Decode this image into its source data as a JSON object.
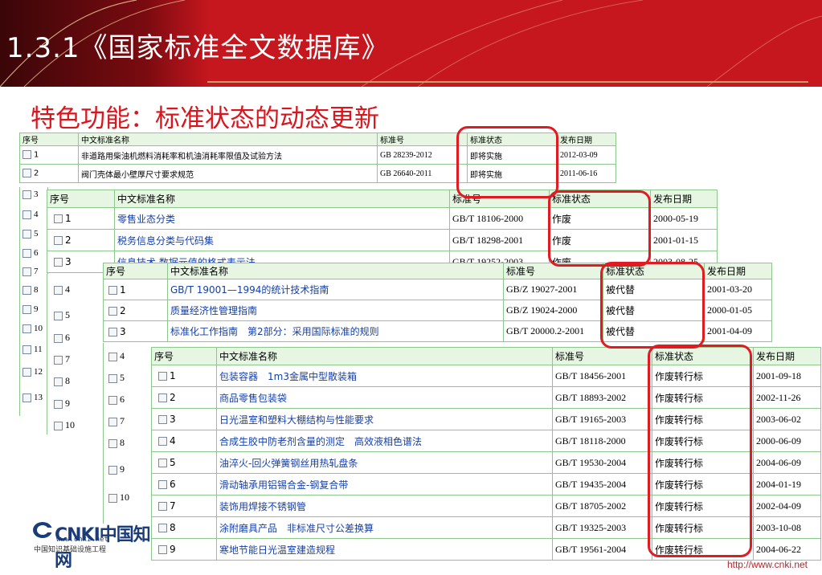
{
  "header": {
    "title": "1.3.1《国家标准全文数据库》"
  },
  "subtitle": "特色功能：标准状态的动态更新",
  "table1": {
    "columns": [
      "序号",
      "中文标准名称",
      "标准号",
      "标准状态",
      "发布日期"
    ],
    "rows": [
      {
        "num": "1",
        "name": "非道路用柴油机燃料消耗率和机油消耗率限值及试验方法",
        "code": "GB 28239-2012",
        "status": "即将实施",
        "date": "2012-03-09"
      },
      {
        "num": "2",
        "name": "阀门壳体最小壁厚尺寸要求规范",
        "code": "GB 26640-2011",
        "status": "即将实施",
        "date": "2011-06-16"
      }
    ],
    "more_nums": [
      "3",
      "4",
      "5",
      "6",
      "7",
      "8",
      "9",
      "10",
      "11",
      "12",
      "13"
    ]
  },
  "table2": {
    "columns": [
      "序号",
      "中文标准名称",
      "标准号",
      "标准状态",
      "发布日期"
    ],
    "rows": [
      {
        "num": "1",
        "name": "零售业态分类",
        "code": "GB/T 18106-2000",
        "status": "作废",
        "date": "2000-05-19"
      },
      {
        "num": "2",
        "name": "税务信息分类与代码集",
        "code": "GB/T 18298-2001",
        "status": "作废",
        "date": "2001-01-15"
      },
      {
        "num": "3",
        "name": "信息技术 数据元值的格式表示法",
        "code": "GB/T 19252-2003",
        "status": "作废",
        "date": "2003-08-25"
      }
    ],
    "more_nums": [
      "4",
      "5",
      "6",
      "7",
      "8",
      "9",
      "10"
    ]
  },
  "table3": {
    "columns": [
      "序号",
      "中文标准名称",
      "标准号",
      "标准状态",
      "发布日期"
    ],
    "rows": [
      {
        "num": "1",
        "name": "GB/T 19001—1994的统计技术指南",
        "code": "GB/Z 19027-2001",
        "status": "被代替",
        "date": "2001-03-20"
      },
      {
        "num": "2",
        "name": "质量经济性管理指南",
        "code": "GB/Z 19024-2000",
        "status": "被代替",
        "date": "2000-01-05"
      },
      {
        "num": "3",
        "name": "标准化工作指南　第2部分：采用国际标准的规则",
        "code": "GB/T 20000.2-2001",
        "status": "被代替",
        "date": "2001-04-09"
      }
    ],
    "more_nums": [
      "4",
      "5",
      "6",
      "7",
      "8",
      "9",
      "10"
    ]
  },
  "table4": {
    "columns": [
      "序号",
      "中文标准名称",
      "标准号",
      "标准状态",
      "发布日期"
    ],
    "rows": [
      {
        "num": "1",
        "name": "包装容器　1m3金属中型散装箱",
        "code": "GB/T 18456-2001",
        "status": "作废转行标",
        "date": "2001-09-18"
      },
      {
        "num": "2",
        "name": "商品零售包装袋",
        "code": "GB/T 18893-2002",
        "status": "作废转行标",
        "date": "2002-11-26"
      },
      {
        "num": "3",
        "name": "日光温室和塑料大棚结构与性能要求",
        "code": "GB/T 19165-2003",
        "status": "作废转行标",
        "date": "2003-06-02"
      },
      {
        "num": "4",
        "name": "合成生胶中防老剂含量的测定　高效液相色谱法",
        "code": "GB/T 18118-2000",
        "status": "作废转行标",
        "date": "2000-06-09"
      },
      {
        "num": "5",
        "name": "油淬火-回火弹簧钢丝用热轧盘条",
        "code": "GB/T 19530-2004",
        "status": "作废转行标",
        "date": "2004-06-09"
      },
      {
        "num": "6",
        "name": "滑动轴承用铝锡合金-钢复合带",
        "code": "GB/T 19435-2004",
        "status": "作废转行标",
        "date": "2004-01-19"
      },
      {
        "num": "7",
        "name": "装饰用焊接不锈钢管",
        "code": "GB/T 18705-2002",
        "status": "作废转行标",
        "date": "2002-04-09"
      },
      {
        "num": "8",
        "name": "涂附磨具产品　非标准尺寸公差换算",
        "code": "GB/T 19325-2003",
        "status": "作废转行标",
        "date": "2003-10-08"
      },
      {
        "num": "9",
        "name": "寒地节能日光温室建造规程",
        "code": "GB/T 19561-2004",
        "status": "作废转行标",
        "date": "2004-06-22"
      }
    ]
  },
  "logo": {
    "brand": "CNKI中国知网",
    "www": "www.cnki.net",
    "org": "中国知识基础设施工程"
  },
  "footer_url": "http://www.cnki.net",
  "colors": {
    "header_red": "#c6161e",
    "subtitle_red": "#d9161e",
    "frame_red": "#e01b22",
    "table_header_green": "#e6f6e2"
  }
}
